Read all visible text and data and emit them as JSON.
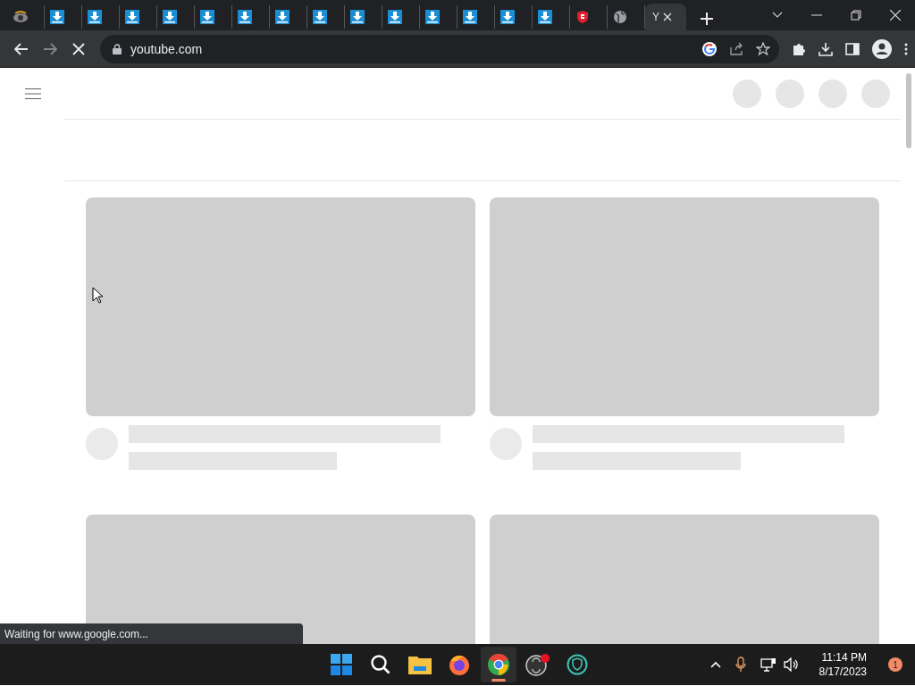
{
  "tabs": [
    {
      "kind": "app",
      "selected": false
    },
    {
      "kind": "download",
      "selected": false
    },
    {
      "kind": "download",
      "selected": false
    },
    {
      "kind": "download",
      "selected": false
    },
    {
      "kind": "download",
      "selected": false
    },
    {
      "kind": "download",
      "selected": false
    },
    {
      "kind": "download",
      "selected": false
    },
    {
      "kind": "download",
      "selected": false
    },
    {
      "kind": "download",
      "selected": false
    },
    {
      "kind": "download",
      "selected": false
    },
    {
      "kind": "download",
      "selected": false
    },
    {
      "kind": "download",
      "selected": false
    },
    {
      "kind": "download",
      "selected": false
    },
    {
      "kind": "download",
      "selected": false
    },
    {
      "kind": "download",
      "selected": false
    },
    {
      "kind": "shield",
      "selected": false
    },
    {
      "kind": "globe",
      "selected": false
    },
    {
      "kind": "page",
      "selected": true,
      "title": "Y"
    }
  ],
  "toolbar": {
    "address": "youtube.com",
    "loading": true
  },
  "page": {
    "cards": [
      {
        "kind": "skeleton"
      },
      {
        "kind": "skeleton"
      },
      {
        "kind": "thumbnail"
      },
      {
        "kind": "thumbnail"
      }
    ]
  },
  "status_bubble": "Waiting for www.google.com...",
  "taskbar": {
    "apps": [
      {
        "kind": "start",
        "selected": false
      },
      {
        "kind": "search",
        "selected": false
      },
      {
        "kind": "folder",
        "selected": false
      },
      {
        "kind": "firefox",
        "selected": false
      },
      {
        "kind": "chrome",
        "selected": true
      },
      {
        "kind": "obs",
        "selected": false
      },
      {
        "kind": "shield",
        "selected": false
      }
    ],
    "time": "11:14 PM",
    "date": "8/17/2023",
    "notifications": "1"
  }
}
